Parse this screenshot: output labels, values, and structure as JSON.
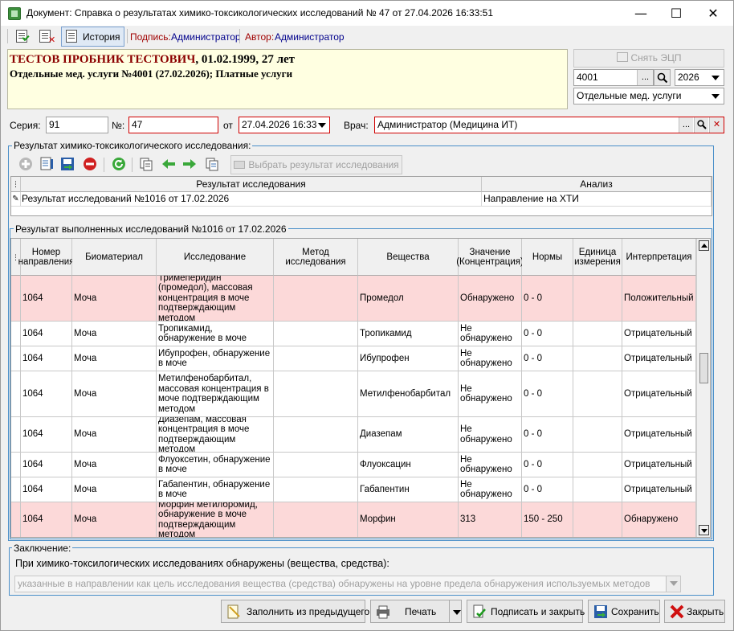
{
  "window": {
    "title": "Документ: Справка о результатах химико-токсикологических исследований № 47 от 27.04.2026 16:33:51",
    "minimize": "—",
    "maximize": "☐",
    "close": "✕"
  },
  "toolbar": {
    "history_label": "История",
    "signature_label": "Подпись:",
    "signature_value": "Администратор",
    "author_label": "Автор:",
    "author_value": "Администратор"
  },
  "patient": {
    "name": "ТЕСТОВ ПРОБНИК ТЕСТОВИЧ",
    "details": ", 01.02.1999, 27 лет",
    "service_line": "Отдельные мед. услуги №4001 (27.02.2026); Платные услуги"
  },
  "right_panel": {
    "remove_signature": "Снять ЭЦП",
    "code": "4001",
    "ellipsis": "...",
    "year": "2026",
    "service_type": "Отдельные мед. услуги"
  },
  "doc_fields": {
    "series_label": "Серия:",
    "series_value": "91",
    "number_label": "№:",
    "number_value": "47",
    "date_label": "от",
    "date_value": "27.04.2026 16:33",
    "doctor_label": "Врач:",
    "doctor_value": "Администратор (Медицина ИТ)",
    "ellipsis": "..."
  },
  "research_group": {
    "title": "Результат химико-токсикологического исследования:",
    "select_button": "Выбрать результат исследования",
    "columns": [
      "Результат исследования",
      "Анализ"
    ],
    "rows": [
      {
        "result": "Результат исследований №1016 от 17.02.2026",
        "analysis": "Направление на ХТИ"
      }
    ]
  },
  "results_group": {
    "title": "Результат выполненных исследований №1016 от 17.02.2026",
    "columns": [
      "Номер направления",
      "Биоматериал",
      "Исследование",
      "Метод исследования",
      "Вещества",
      "Значение (Концентрация)",
      "Нормы",
      "Единица измерения",
      "Интерпретация"
    ],
    "rows": [
      {
        "num": "1064",
        "bio": "Моча",
        "study": "Тримеперидин (промедол), массовая концентрация в моче подтверждающим методом",
        "method": "",
        "substance": "Промедол",
        "value": "Обнаружено",
        "norm": "0 - 0",
        "unit": "",
        "interp": "Положительный",
        "highlight": true
      },
      {
        "num": "1064",
        "bio": "Моча",
        "study": "Тропикамид, обнаружение в моче",
        "method": "",
        "substance": "Тропикамид",
        "value": "Не обнаружено",
        "norm": "0 - 0",
        "unit": "",
        "interp": "Отрицательный",
        "highlight": false
      },
      {
        "num": "1064",
        "bio": "Моча",
        "study": "Ибупрофен, обнаружение в моче",
        "method": "",
        "substance": "Ибупрофен",
        "value": "Не обнаружено",
        "norm": "0 - 0",
        "unit": "",
        "interp": "Отрицательный",
        "highlight": false
      },
      {
        "num": "1064",
        "bio": "Моча",
        "study": "Метилфенобарбитал, массовая концентрация в моче подтверждающим методом",
        "method": "",
        "substance": "Метилфенобарбитал",
        "value": "Не обнаружено",
        "norm": "0 - 0",
        "unit": "",
        "interp": "Отрицательный",
        "highlight": false
      },
      {
        "num": "1064",
        "bio": "Моча",
        "study": "Диазепам, массовая концентрация в моче подтверждающим методом",
        "method": "",
        "substance": "Диазепам",
        "value": "Не обнаружено",
        "norm": "0 - 0",
        "unit": "",
        "interp": "Отрицательный",
        "highlight": false
      },
      {
        "num": "1064",
        "bio": "Моча",
        "study": "Флуоксетин, обнаружение в моче",
        "method": "",
        "substance": "Флуоксацин",
        "value": "Не обнаружено",
        "norm": "0 - 0",
        "unit": "",
        "interp": "Отрицательный",
        "highlight": false
      },
      {
        "num": "1064",
        "bio": "Моча",
        "study": "Габапентин, обнаружение в моче",
        "method": "",
        "substance": "Габапентин",
        "value": "Не обнаружено",
        "norm": "0 - 0",
        "unit": "",
        "interp": "Отрицательный",
        "highlight": false
      },
      {
        "num": "1064",
        "bio": "Моча",
        "study": "Морфин метилбромид, обнаружение в моче подтверждающим методом",
        "method": "",
        "substance": "Морфин",
        "value": "313",
        "norm": "150 - 250",
        "unit": "",
        "interp": "Обнаружено",
        "highlight": true
      }
    ]
  },
  "conclusion": {
    "title": "Заключение:",
    "label": "При химико-токсилогических исследованиях обнаружены (вещества, средства):",
    "value": "указанные в направлении как цель исследования вещества (средства) обнаружены на уровне предела обнаружения используемых методов"
  },
  "bottom": {
    "fill_prev": "Заполнить из предыдущего",
    "print": "Печать",
    "sign_close": "Подписать и закрыть",
    "save": "Сохранить",
    "close": "Закрыть"
  },
  "colors": {
    "highlight_row": "#fcd9d9",
    "group_border": "#4a8fc9",
    "required_border": "#d00000",
    "header_bg": "#ffffe1"
  }
}
